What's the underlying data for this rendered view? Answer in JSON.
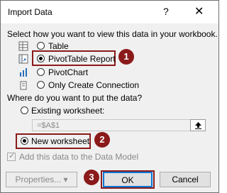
{
  "dialog": {
    "title": "Import Data",
    "help_glyph": "?",
    "close_glyph": "✕",
    "prompt_view": "Select how you want to view this data in your workbook.",
    "view_options": [
      {
        "label": "Table",
        "selected": false
      },
      {
        "label": "PivotTable Report",
        "selected": true
      },
      {
        "label": "PivotChart",
        "selected": false
      },
      {
        "label": "Only Create Connection",
        "selected": false
      }
    ],
    "prompt_location": "Where do you want to put the data?",
    "location_options": [
      {
        "label": "Existing worksheet:",
        "selected": false
      },
      {
        "label": "New worksheet",
        "selected": true
      }
    ],
    "range_value": "=$A$1",
    "add_to_model_label": "Add this data to the Data Model",
    "properties_button": "Properties...",
    "properties_dropdown_glyph": "▾",
    "ok_button": "OK",
    "cancel_button": "Cancel"
  },
  "callouts": [
    {
      "number": "1"
    },
    {
      "number": "2"
    },
    {
      "number": "3"
    }
  ],
  "colors": {
    "callout": "#8b1a1a",
    "accent": "#0078d7"
  }
}
